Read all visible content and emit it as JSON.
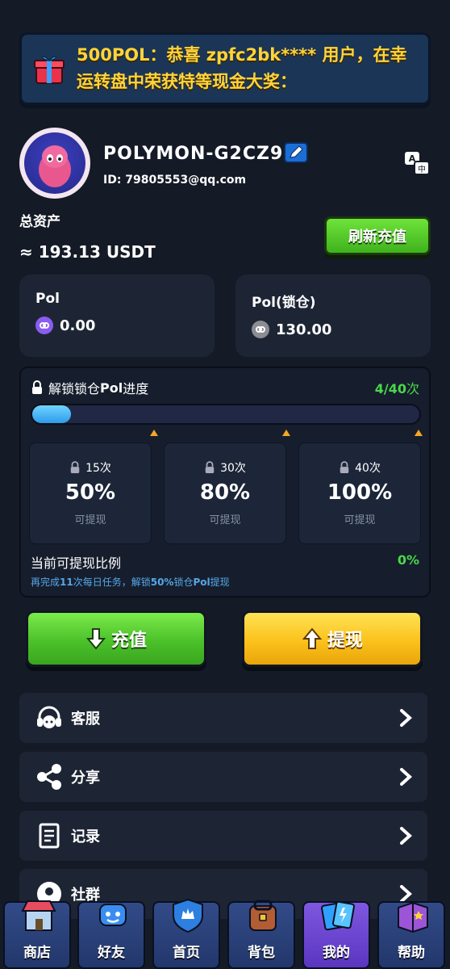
{
  "banner": {
    "text": "500POL：恭喜 zpfc2bk**** 用户，在幸运转盘中荣获特等现金大奖：",
    "icon": "gift-icon"
  },
  "profile": {
    "nickname": "POLYMON-G2CZ9",
    "id_label": "ID: 79805553@qq.com"
  },
  "assets": {
    "label": "总资产",
    "value": "≈ 193.13 USDT",
    "refresh_button": "刷新充值"
  },
  "balances": [
    {
      "name": "Pol",
      "value": "0.00",
      "coin_color": "#8a5cf0"
    },
    {
      "name": "Pol(锁仓)",
      "value": "130.00",
      "coin_color": "#8c8c94"
    }
  ],
  "unlock": {
    "title_prefix": "解锁锁仓",
    "title_bold": "Pol",
    "title_suffix": "进度",
    "count": "4/40",
    "count_unit": "次",
    "progress_fraction": 0.1,
    "tiers": [
      {
        "times": "15次",
        "percent": "50%",
        "label": "可提现"
      },
      {
        "times": "30次",
        "percent": "80%",
        "label": "可提现"
      },
      {
        "times": "40次",
        "percent": "100%",
        "label": "可提现"
      }
    ],
    "ratio_label": "当前可提现比例",
    "ratio_value": "0%",
    "hint_1": "再完成",
    "hint_2": "11",
    "hint_3": "次每日任务，解锁",
    "hint_4": "50%",
    "hint_5": "锁仓",
    "hint_6": "Pol",
    "hint_7": "提现"
  },
  "actions": {
    "deposit": "充值",
    "withdraw": "提现"
  },
  "menu": [
    {
      "label": "客服",
      "icon": "headset-icon"
    },
    {
      "label": "分享",
      "icon": "share-icon"
    },
    {
      "label": "记录",
      "icon": "receipt-icon"
    },
    {
      "label": "社群",
      "icon": "community-icon"
    }
  ],
  "nav": [
    {
      "label": "商店",
      "icon": "shop-icon"
    },
    {
      "label": "好友",
      "icon": "friends-icon"
    },
    {
      "label": "首页",
      "icon": "home-shield-icon"
    },
    {
      "label": "背包",
      "icon": "backpack-icon"
    },
    {
      "label": "我的",
      "icon": "cards-icon"
    },
    {
      "label": "帮助",
      "icon": "help-book-icon"
    }
  ]
}
